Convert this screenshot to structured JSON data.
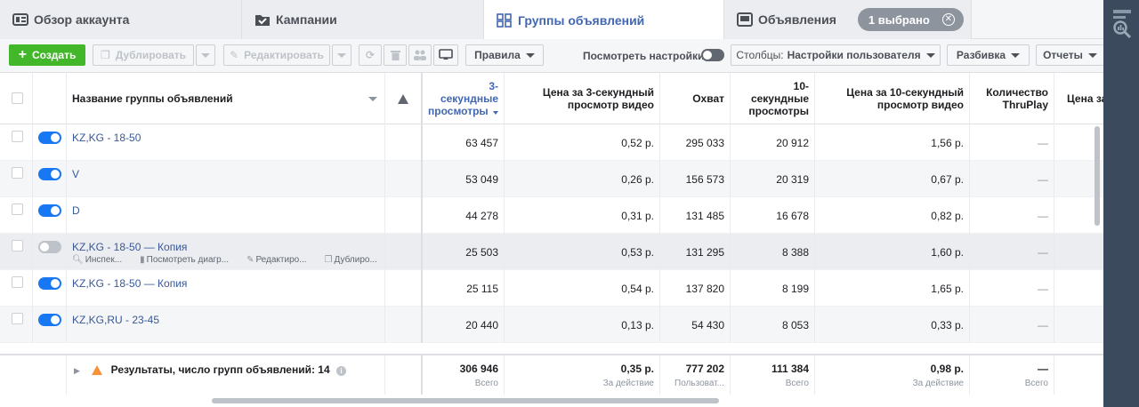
{
  "tabs": [
    {
      "label": "Обзор аккаунта",
      "icon": "account-overview-icon"
    },
    {
      "label": "Кампании",
      "icon": "campaigns-icon"
    },
    {
      "label": "Группы объявлений",
      "icon": "ad-sets-icon",
      "active": true
    },
    {
      "label": "Объявления",
      "icon": "ads-icon",
      "badge": "1 выбрано"
    }
  ],
  "toolbar": {
    "create": "Создать",
    "duplicate": "Дублировать",
    "edit": "Редактировать",
    "rules": "Правила",
    "view_settings": "Посмотреть настройки",
    "columns_prefix": "Столбцы:",
    "columns_value": "Настройки пользователя",
    "breakdown": "Разбивка",
    "reports": "Отчеты"
  },
  "headers": {
    "name": "Название группы объявлений",
    "views3": [
      "3-",
      "секундные",
      "просмотры"
    ],
    "cost3": [
      "Цена за 3-секундный",
      "просмотр видео"
    ],
    "reach": "Охват",
    "views10": [
      "10-",
      "секундные",
      "просмотры"
    ],
    "cost10": [
      "Цена за 10-секундный",
      "просмотр видео"
    ],
    "thruplay": [
      "Количество",
      "ThruPlay"
    ],
    "cost_thru": "Цена за"
  },
  "rows": [
    {
      "name": "KZ,KG - 18-50",
      "views3": "63 457",
      "cost3": "0,52 р.",
      "reach": "295 033",
      "views10": "20 912",
      "cost10": "1,56 р.",
      "thruplay": "—"
    },
    {
      "name": "V",
      "views3": "53 049",
      "cost3": "0,26 р.",
      "reach": "156 573",
      "views10": "20 319",
      "cost10": "0,67 р.",
      "thruplay": "—"
    },
    {
      "name": "D",
      "views3": "44 278",
      "cost3": "0,31 р.",
      "reach": "131 485",
      "views10": "16 678",
      "cost10": "0,82 р.",
      "thruplay": "—"
    },
    {
      "name": "KZ,KG - 18-50 — Копия",
      "views3": "25 503",
      "cost3": "0,53 р.",
      "reach": "131 295",
      "views10": "8 388",
      "cost10": "1,60 р.",
      "thruplay": "—"
    },
    {
      "name": "KZ,KG - 18-50 — Копия",
      "views3": "25 115",
      "cost3": "0,54 р.",
      "reach": "137 820",
      "views10": "8 199",
      "cost10": "1,65 р.",
      "thruplay": "—"
    },
    {
      "name": "KZ,KG,RU - 23-45",
      "views3": "20 440",
      "cost3": "0,13 р.",
      "reach": "54 430",
      "views10": "8 053",
      "cost10": "0,33 р.",
      "thruplay": "—"
    }
  ],
  "row_actions": [
    "Инспек...",
    "Посмотреть диагр...",
    "Редактиро...",
    "Дублиро..."
  ],
  "footer": {
    "summary": "Результаты, число групп объявлений: 14",
    "views3": "306 946",
    "views3_l": "Всего",
    "cost3": "0,35 р.",
    "cost3_l": "За действие",
    "reach": "777 202",
    "reach_l": "Пользоват...",
    "views10": "111 384",
    "views10_l": "Всего",
    "cost10": "0,98 р.",
    "cost10_l": "За действие",
    "thruplay": "—",
    "thruplay_l": "Всего"
  }
}
